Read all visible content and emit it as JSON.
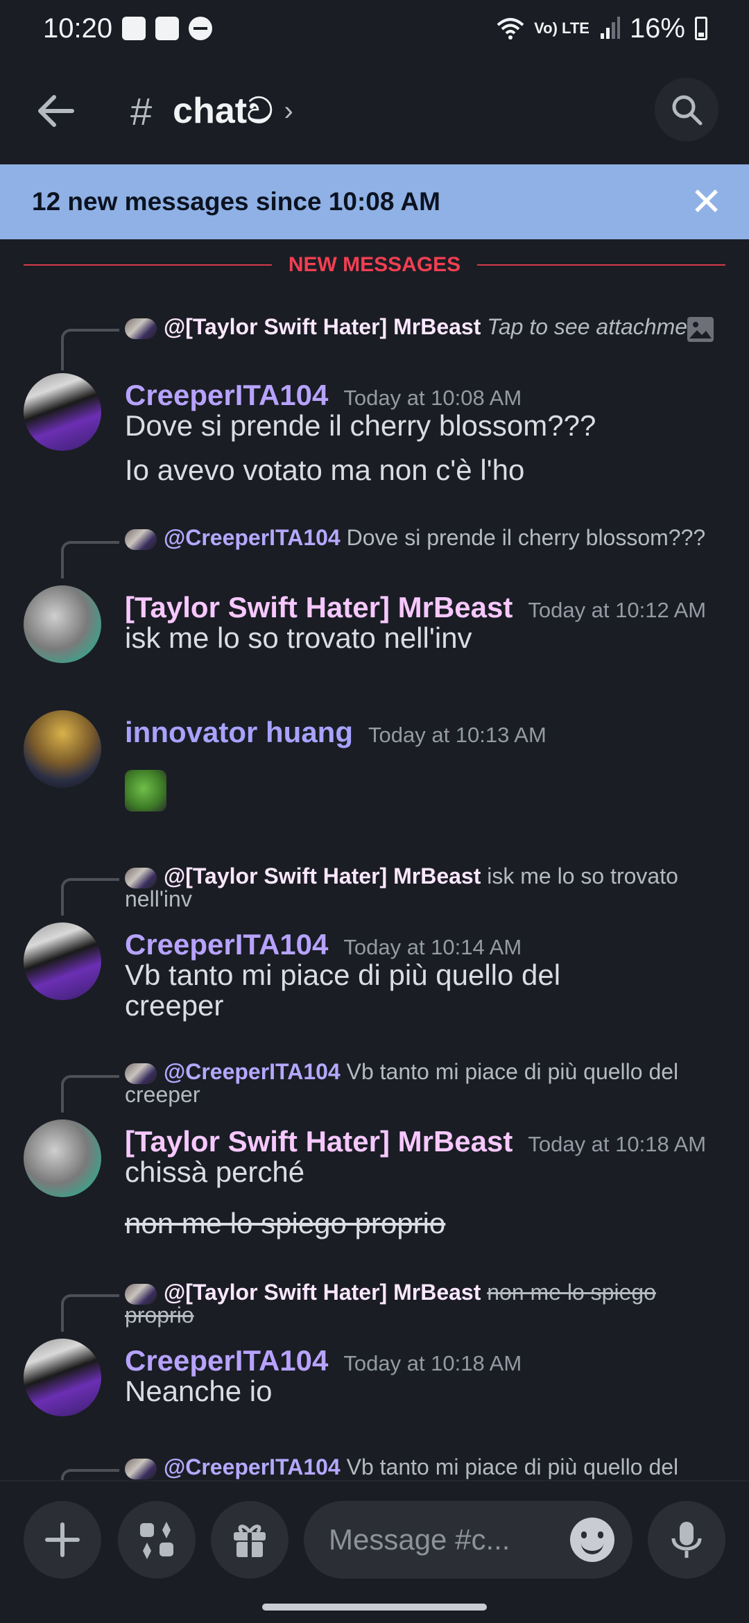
{
  "status_bar": {
    "time": "10:20",
    "network": "Vo) LTE",
    "battery": "16%"
  },
  "header": {
    "channel_name": "chatව"
  },
  "banner": {
    "text": "12 new messages since 10:08 AM",
    "close": "✕"
  },
  "divider": {
    "label": "NEW MESSAGES"
  },
  "messages": [
    {
      "reply": {
        "mention": "@[Taylor Swift Hater] MrBeast",
        "text": "Tap to see attachment"
      },
      "author": "CreeperITA104",
      "time": "Today at 10:08 AM",
      "lines": [
        "Dove si prende il cherry blossom???",
        "Io avevo votato ma non c'è l'ho"
      ]
    },
    {
      "reply": {
        "mention": "@CreeperITA104",
        "text": "Dove si prende il cherry blossom???"
      },
      "author": "[Taylor Swift Hater] MrBeast",
      "time": "Today at 10:12 AM",
      "lines": [
        "isk me lo so trovato nell'inv"
      ]
    },
    {
      "author": "innovator huang",
      "time": "Today at 10:13 AM"
    },
    {
      "reply": {
        "mention": "@[Taylor Swift Hater] MrBeast",
        "text": "isk me lo so trovato nell'inv"
      },
      "author": "CreeperITA104",
      "time": "Today at 10:14 AM",
      "lines": [
        "Vb tanto mi piace di più quello del creeper"
      ]
    },
    {
      "reply": {
        "mention": "@CreeperITA104",
        "text": "Vb tanto mi piace di più quello del creeper"
      },
      "author": "[Taylor Swift Hater] MrBeast",
      "time": "Today at 10:18 AM",
      "lines": [
        "chissà perché",
        "non me lo spiego proprio"
      ]
    },
    {
      "reply": {
        "mention": "@[Taylor Swift Hater] MrBeast",
        "text": "non me lo spiego proprio"
      },
      "author": "CreeperITA104",
      "time": "Today at 10:18 AM",
      "lines": [
        "Neanche io"
      ]
    },
    {
      "reply": {
        "mention": "@CreeperITA104",
        "text": "Vb tanto mi piace di più quello del"
      }
    }
  ],
  "composer": {
    "placeholder": "Message #c..."
  },
  "colors": {
    "background": "#1a1d24",
    "banner": "#8fb1e5",
    "new_messages_red": "#f23f52",
    "name_purple": "#b7a3ff",
    "name_pink": "#f7c8ff"
  }
}
